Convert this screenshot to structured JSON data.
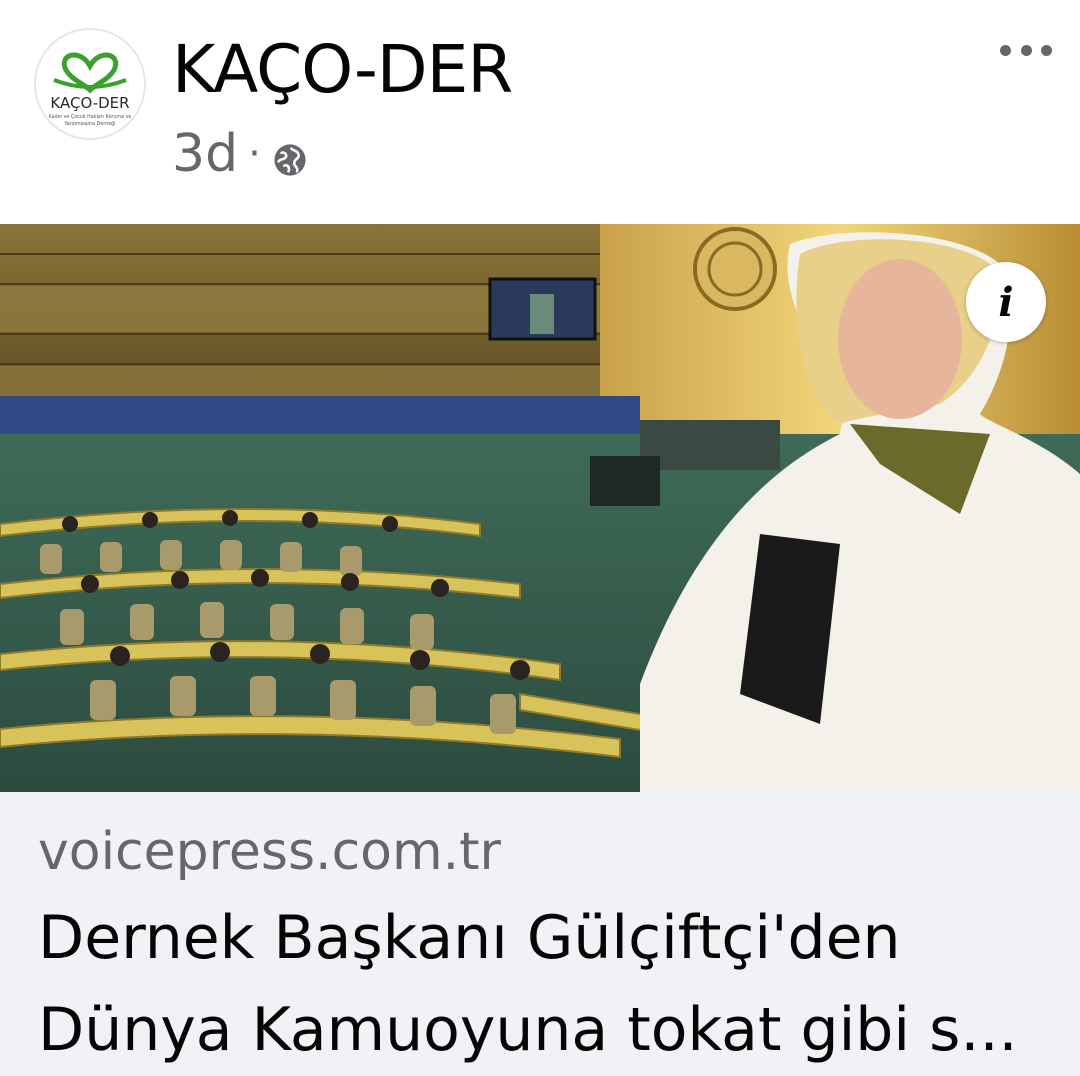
{
  "post": {
    "page_name": "KAÇO-DER",
    "time": "3d",
    "separator": "·",
    "audience_icon": "globe-icon",
    "more_icon": "more-horizontal-icon",
    "avatar": {
      "logo_text": "KAÇO-DER",
      "tagline_1": "Kadın ve Çocuk Hakları Koruma ve",
      "tagline_2": "Yardımlaşma Derneği",
      "brand_color": "#3aa02e"
    }
  },
  "link_preview": {
    "image_description_icon": "info-icon",
    "info_label": "i",
    "domain": "voicepress.com.tr",
    "title_line_1": "Dernek Başkanı Gülçiftçi'den",
    "title_line_2": "Dünya Kamuoyuna tokat gibi s..."
  },
  "colors": {
    "text_primary": "#050505",
    "text_secondary": "#65676b",
    "footer_bg": "#f0f2f5"
  }
}
